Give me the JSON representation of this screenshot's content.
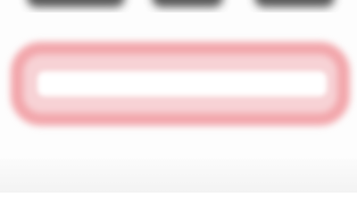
{
  "field": {
    "value": "",
    "placeholder": "",
    "state": "error-highlighted",
    "highlight_color": "#f2a6ab"
  },
  "colors": {
    "background": "#fdfdfd",
    "header_blur": "#3a3a3a",
    "input_fill": "#ffffff"
  }
}
